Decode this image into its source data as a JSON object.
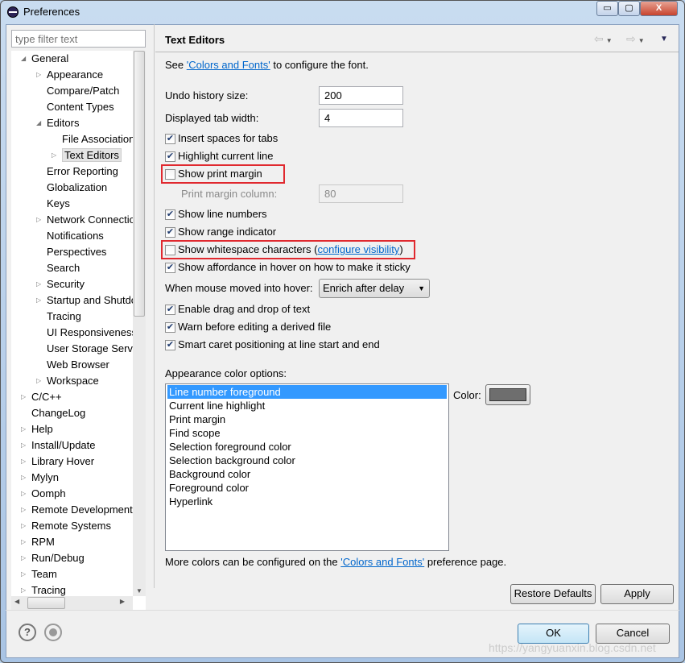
{
  "window": {
    "title": "Preferences",
    "minimize": "▭",
    "maximize": "▢",
    "close": "X"
  },
  "filter": {
    "placeholder": "type filter text"
  },
  "tree": [
    {
      "label": "General",
      "level": 0,
      "expanded": true
    },
    {
      "label": "Appearance",
      "level": 1,
      "arrow": true
    },
    {
      "label": "Compare/Patch",
      "level": 1
    },
    {
      "label": "Content Types",
      "level": 1
    },
    {
      "label": "Editors",
      "level": 1,
      "expanded": true
    },
    {
      "label": "File Associations",
      "level": 2
    },
    {
      "label": "Text Editors",
      "level": 2,
      "arrow": true,
      "selected": true
    },
    {
      "label": "Error Reporting",
      "level": 1
    },
    {
      "label": "Globalization",
      "level": 1
    },
    {
      "label": "Keys",
      "level": 1
    },
    {
      "label": "Network Connections",
      "level": 1,
      "arrow": true
    },
    {
      "label": "Notifications",
      "level": 1
    },
    {
      "label": "Perspectives",
      "level": 1
    },
    {
      "label": "Search",
      "level": 1
    },
    {
      "label": "Security",
      "level": 1,
      "arrow": true
    },
    {
      "label": "Startup and Shutdown",
      "level": 1,
      "arrow": true
    },
    {
      "label": "Tracing",
      "level": 1
    },
    {
      "label": "UI Responsiveness",
      "level": 1
    },
    {
      "label": "User Storage Service",
      "level": 1
    },
    {
      "label": "Web Browser",
      "level": 1
    },
    {
      "label": "Workspace",
      "level": 1,
      "arrow": true
    },
    {
      "label": "C/C++",
      "level": 0,
      "arrow": true
    },
    {
      "label": "ChangeLog",
      "level": 0
    },
    {
      "label": "Help",
      "level": 0,
      "arrow": true
    },
    {
      "label": "Install/Update",
      "level": 0,
      "arrow": true
    },
    {
      "label": "Library Hover",
      "level": 0,
      "arrow": true
    },
    {
      "label": "Mylyn",
      "level": 0,
      "arrow": true
    },
    {
      "label": "Oomph",
      "level": 0,
      "arrow": true
    },
    {
      "label": "Remote Development",
      "level": 0,
      "arrow": true
    },
    {
      "label": "Remote Systems",
      "level": 0,
      "arrow": true
    },
    {
      "label": "RPM",
      "level": 0,
      "arrow": true
    },
    {
      "label": "Run/Debug",
      "level": 0,
      "arrow": true
    },
    {
      "label": "Team",
      "level": 0,
      "arrow": true
    },
    {
      "label": "Tracing",
      "level": 0,
      "arrow": true
    }
  ],
  "page": {
    "title": "Text Editors",
    "intro_pre": "See ",
    "intro_link": "'Colors and Fonts'",
    "intro_post": " to configure the font.",
    "undo_label": "Undo history size:",
    "undo_value": "200",
    "tab_label": "Displayed tab width:",
    "tab_value": "4",
    "checks": [
      {
        "label": "Insert spaces for tabs",
        "checked": true
      },
      {
        "label": "Highlight current line",
        "checked": true
      },
      {
        "label": "Show print margin",
        "checked": false
      },
      {
        "label": "Show line numbers",
        "checked": true
      },
      {
        "label": "Show range indicator",
        "checked": true
      },
      {
        "label": "Show whitespace characters",
        "checked": false,
        "link": "configure visibility"
      },
      {
        "label": "Show affordance in hover on how to make it sticky",
        "checked": true
      },
      {
        "label": "Enable drag and drop of text",
        "checked": true
      },
      {
        "label": "Warn before editing a derived file",
        "checked": true
      },
      {
        "label": "Smart caret positioning at line start and end",
        "checked": true
      }
    ],
    "margin_label": "Print margin column:",
    "margin_value": "80",
    "hover_label": "When mouse moved into hover:",
    "hover_value": "Enrich after delay",
    "appearance_label": "Appearance color options:",
    "color_options": [
      "Line number foreground",
      "Current line highlight",
      "Print margin",
      "Find scope",
      "Selection foreground color",
      "Selection background color",
      "Background color",
      "Foreground color",
      "Hyperlink"
    ],
    "color_label": "Color:",
    "color_value": "#6e6e6e",
    "footer_pre": "More colors can be configured on the ",
    "footer_link": "'Colors and Fonts'",
    "footer_post": " preference page.",
    "restore": "Restore Defaults",
    "apply": "Apply"
  },
  "buttons": {
    "ok": "OK",
    "cancel": "Cancel"
  },
  "watermark": "https://yangyuanxin.blog.csdn.net"
}
